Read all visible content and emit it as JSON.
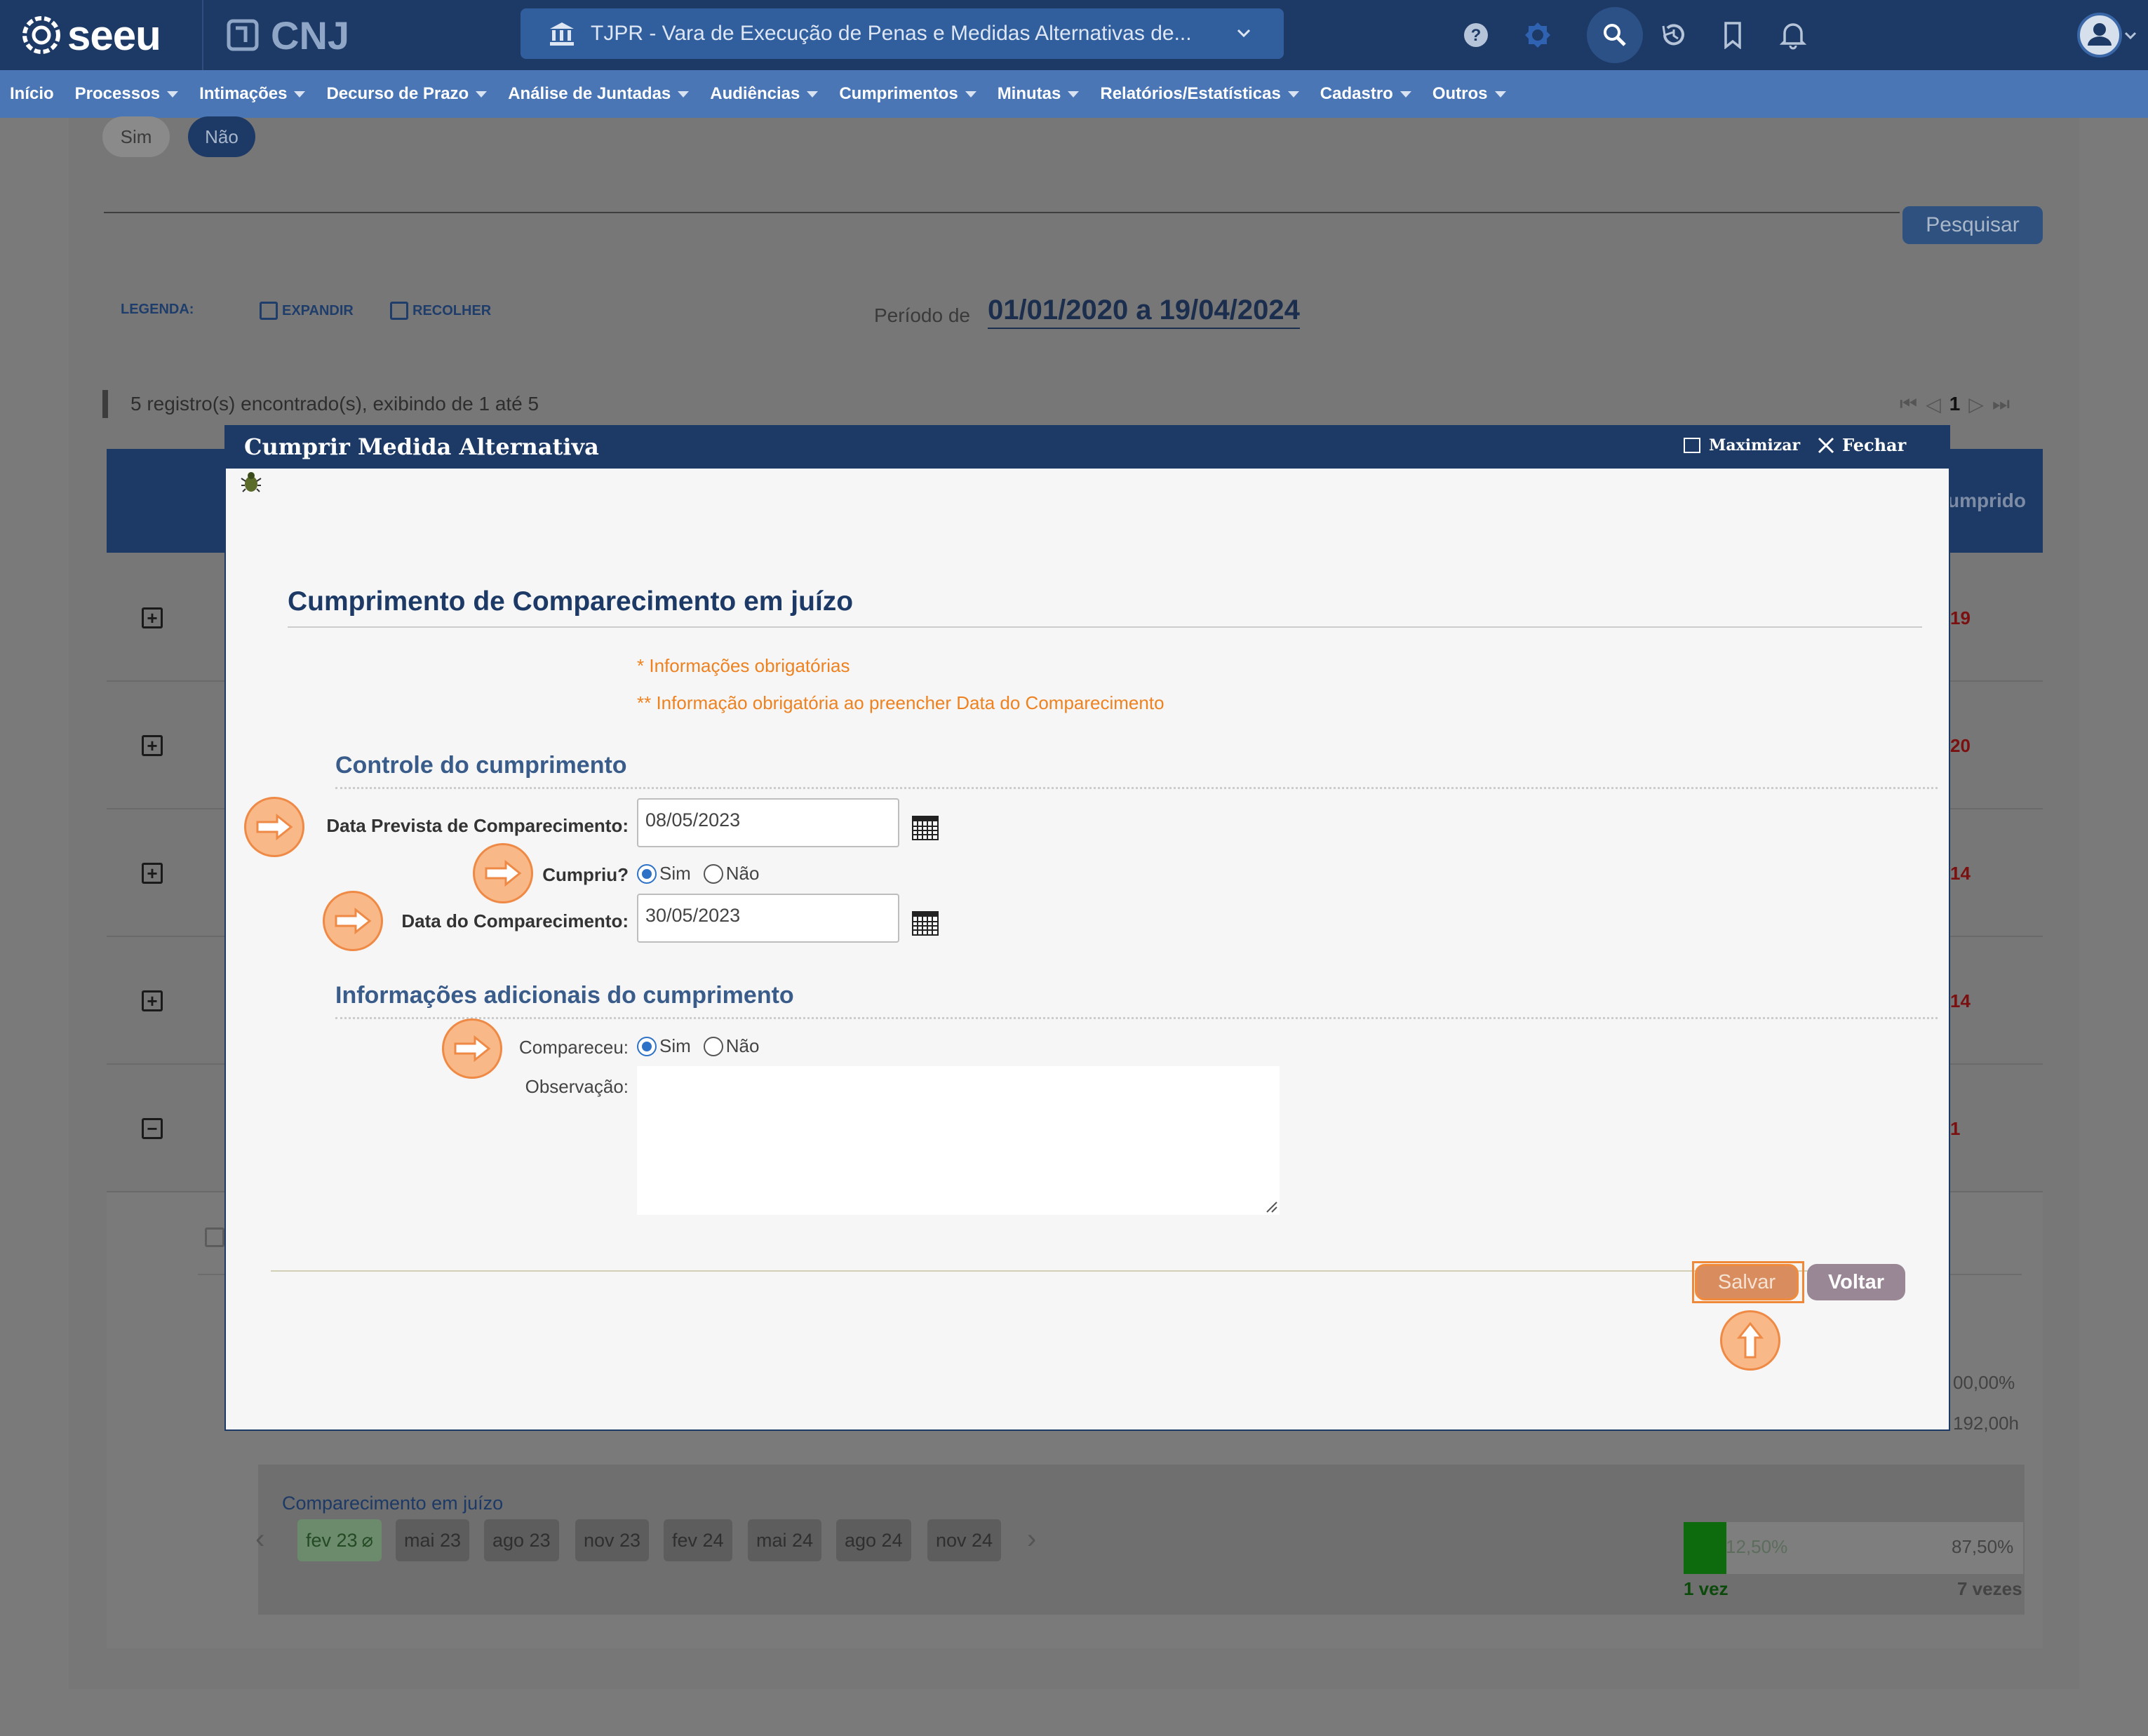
{
  "topbar": {
    "logo_text": "seeu",
    "cnj_text": "CNJ",
    "court_selector": "TJPR - Vara de Execução de Penas e Medidas Alternativas de...",
    "colors": {
      "topbar": "#1d3a66",
      "menubar": "#4a76b6",
      "accent_orange": "#ee8220"
    }
  },
  "menu": {
    "items": [
      {
        "label": "Início",
        "has_caret": false
      },
      {
        "label": "Processos",
        "has_caret": true
      },
      {
        "label": "Intimações",
        "has_caret": true
      },
      {
        "label": "Decurso de Prazo",
        "has_caret": true
      },
      {
        "label": "Análise de Juntadas",
        "has_caret": true
      },
      {
        "label": "Audiências",
        "has_caret": true
      },
      {
        "label": "Cumprimentos",
        "has_caret": true
      },
      {
        "label": "Minutas",
        "has_caret": true
      },
      {
        "label": "Relatórios/Estatísticas",
        "has_caret": true
      },
      {
        "label": "Cadastro",
        "has_caret": true
      },
      {
        "label": "Outros",
        "has_caret": true
      }
    ]
  },
  "background": {
    "filter_sim": "Sim",
    "filter_nao": "Não",
    "pesquisar": "Pesquisar",
    "legend_label": "LEGENDA:",
    "legend_expand": "EXPANDIR",
    "legend_collapse": "RECOLHER",
    "periodo_label": "Período de",
    "periodo_value": "01/01/2020 a 19/04/2024",
    "records_text": "5 registro(s) encontrado(s), exibindo de 1 até 5",
    "pager_page": "1",
    "col_cumprido": "umprido",
    "row_values": [
      "19",
      "20",
      "14",
      "14",
      "1"
    ],
    "pct_100": "00,00%",
    "hours": "192,00h",
    "comparecimento_title": "Comparecimento em juízo",
    "months": [
      "fev 23",
      "mai 23",
      "ago 23",
      "nov 23",
      "fev 24",
      "mai 24",
      "ago 24",
      "nov 24"
    ],
    "progress_left_pct": "12,50%",
    "progress_right_pct": "87,50%",
    "progress_fraction": 0.125,
    "count_left": "1 vez",
    "count_right": "7 vezes"
  },
  "modal": {
    "title": "Cumprir Medida Alternativa",
    "maximize": "Maximizar",
    "close": "Fechar",
    "form_title": "Cumprimento de Comparecimento em juízo",
    "required_note": "* Informações obrigatórias",
    "required_note2": "** Informação obrigatória ao preencher Data do Comparecimento",
    "section1": "Controle do cumprimento",
    "section2": "Informações adicionais do cumprimento",
    "label_data_prevista": "Data Prevista de Comparecimento:",
    "value_data_prevista": "08/05/2023",
    "label_cumpriu": "Cumpriu?",
    "label_data_comparecimento": "Data do Comparecimento:",
    "value_data_comparecimento": "30/05/2023",
    "label_compareceu": "Compareceu:",
    "label_observacao": "Observação:",
    "observacao_value": "",
    "radio_sim": "Sim",
    "radio_nao": "Não",
    "cumpriu_selected": "Sim",
    "compareceu_selected": "Sim",
    "btn_salvar": "Salvar",
    "btn_voltar": "Voltar"
  }
}
